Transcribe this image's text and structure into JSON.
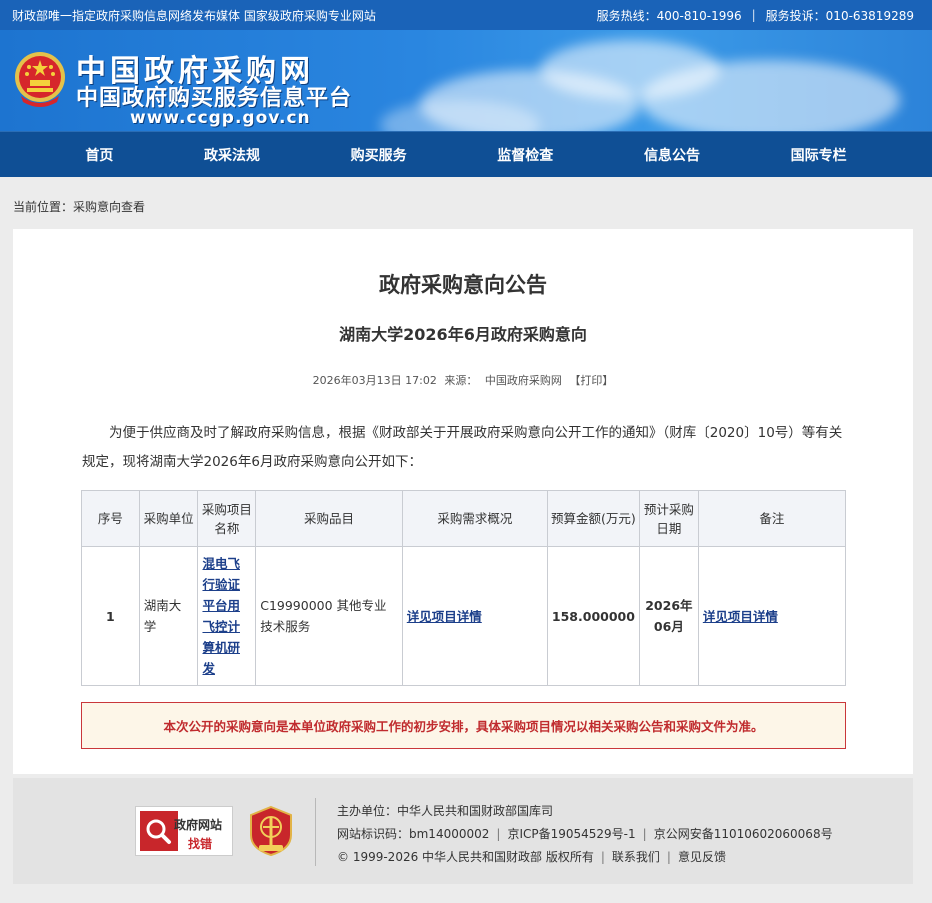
{
  "topbar": {
    "left_text": "财政部唯一指定政府采购信息网络发布媒体 国家级政府采购专业网站",
    "hotline": "服务热线：400-810-1996",
    "complaint": "服务投诉：010-63819289"
  },
  "header": {
    "title": "中国政府采购网",
    "subtitle": "中国政府购买服务信息平台",
    "url": "www.ccgp.gov.cn"
  },
  "nav": {
    "items": [
      "首页",
      "政采法规",
      "购买服务",
      "监督检查",
      "信息公告",
      "国际专栏"
    ]
  },
  "breadcrumb": "当前位置：采购意向查看",
  "article": {
    "title": "政府采购意向公告",
    "subtitle": "湖南大学2026年6月政府采购意向",
    "date": "2026年03月13日 17:02",
    "source_label": "来源：",
    "source": "中国政府采购网",
    "print": "【打印】",
    "intro": "为便于供应商及时了解政府采购信息，根据《财政部关于开展政府采购意向公开工作的通知》（财库〔2020〕10号）等有关规定，现将湖南大学2026年6月政府采购意向公开如下："
  },
  "table": {
    "headers": [
      "序号",
      "采购单位",
      "采购项目名称",
      "采购品目",
      "采购需求概况",
      "预算金额(万元)",
      "预计采购日期",
      "备注"
    ],
    "rows": [
      {
        "index": "1",
        "unit": "湖南大学",
        "project": "混电飞行验证平台用飞控计算机研发",
        "category": "C19990000 其他专业技术服务",
        "demand": "详见项目详情",
        "budget": "158.000000",
        "date": "2026年06月",
        "remark": "详见项目详情"
      }
    ]
  },
  "notice": "本次公开的采购意向是本单位政府采购工作的初步安排，具体采购项目情况以相关采购公告和采购文件为准。",
  "footer": {
    "badge_title": "政府网站",
    "badge_sub": "找错",
    "sponsor": "主办单位：中华人民共和国财政部国库司",
    "site_code": "网站标识码：bm14000002",
    "icp": "京ICP备19054529号-1",
    "police": "京公网安备11010602060068号",
    "copyright": "© 1999-2026 中华人民共和国财政部 版权所有",
    "contact": "联系我们",
    "feedback": "意见反馈"
  },
  "colors": {
    "topbar": "#1a63b8",
    "nav": "#0f4f95",
    "link": "#1c3f8a",
    "notice_text": "#c02b2e"
  }
}
